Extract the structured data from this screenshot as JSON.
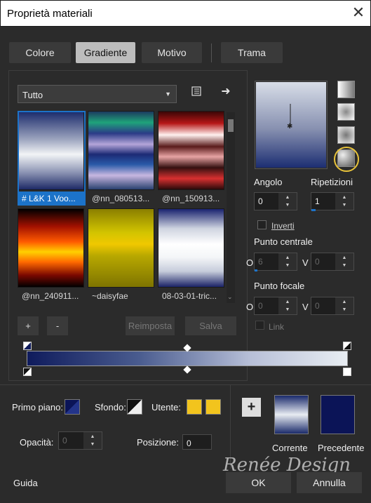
{
  "window": {
    "title": "Proprietà materiali",
    "close_icon": "close-icon"
  },
  "tabs": [
    {
      "label": "Colore"
    },
    {
      "label": "Gradiente"
    },
    {
      "label": "Motivo"
    },
    {
      "label": "Trama"
    }
  ],
  "preset_dropdown": {
    "value": "Tutto"
  },
  "presets": [
    {
      "label": "# L&K 1 Voo..."
    },
    {
      "label": "@nn_080513..."
    },
    {
      "label": "@nn_150913..."
    },
    {
      "label": "@nn_240911..."
    },
    {
      "label": "~daisyfae"
    },
    {
      "label": "08-03-01-tric..."
    }
  ],
  "buttons": {
    "add": "+",
    "remove": "-",
    "reset": "Reimposta",
    "save": "Salva"
  },
  "angle": {
    "label": "Angolo",
    "value": "0"
  },
  "repeats": {
    "label": "Ripetizioni",
    "value": "1"
  },
  "invert": {
    "label": "Inverti"
  },
  "center_point": {
    "label": "Punto centrale",
    "o_label": "O",
    "o_value": "6",
    "v_label": "V",
    "v_value": "0"
  },
  "focal_point": {
    "label": "Punto focale",
    "o_label": "O",
    "o_value": "0",
    "v_label": "V",
    "v_value": "0"
  },
  "link": {
    "label": "Link"
  },
  "foreground": {
    "label": "Primo piano:"
  },
  "background": {
    "label": "Sfondo:"
  },
  "user": {
    "label": "Utente:",
    "color": "#f2c41d"
  },
  "opacity": {
    "label": "Opacità:",
    "value": "0"
  },
  "position": {
    "label": "Posizione:",
    "value": "0"
  },
  "current": {
    "label": "Corrente"
  },
  "previous": {
    "label": "Precedente",
    "color": "#0b1457"
  },
  "footer": {
    "help": "Guida",
    "ok": "OK",
    "cancel": "Annulla"
  },
  "watermark": "Renée Design",
  "colors": {
    "selection": "#1c73c9",
    "highlight": "#e8c33a"
  }
}
